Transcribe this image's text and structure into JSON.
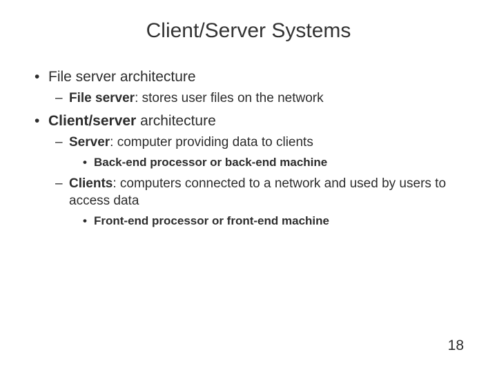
{
  "title": "Client/Server Systems",
  "bullets": {
    "b0_text": "File server architecture",
    "b0_0_bold": "File server",
    "b0_0_rest": ": stores user files on the network",
    "b1_bold": "Client/server",
    "b1_rest": " architecture",
    "b1_0_bold": "Server",
    "b1_0_rest": ": computer providing data to clients",
    "b1_0_0": "Back-end processor or back-end machine",
    "b1_1_bold": "Clients",
    "b1_1_rest": ": computers connected to a network and used by users to access data",
    "b1_1_0": "Front-end processor or front-end machine"
  },
  "page_number": "18"
}
